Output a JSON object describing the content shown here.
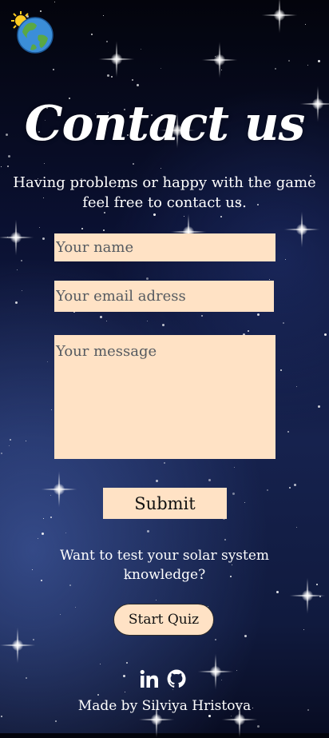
{
  "header": {
    "logo_icon": "earth-with-sun-icon"
  },
  "page": {
    "title": "Contact us",
    "subtitle": "Having problems or happy with the game feel free to contact us."
  },
  "form": {
    "name_placeholder": "Your name",
    "email_placeholder": "Your email adress",
    "message_placeholder": "Your message",
    "submit_label": "Submit"
  },
  "quiz": {
    "prompt": "Want to test your solar system knowledge?",
    "button_label": "Start Quiz"
  },
  "footer": {
    "social_icons": [
      "linkedin-icon",
      "github-icon"
    ],
    "credit": "Made by Silviya Hristova"
  },
  "colors": {
    "field_background": "#ffe2c5",
    "text": "#ffffff",
    "background_dark": "#03040c",
    "background_blue": "#16224e"
  }
}
